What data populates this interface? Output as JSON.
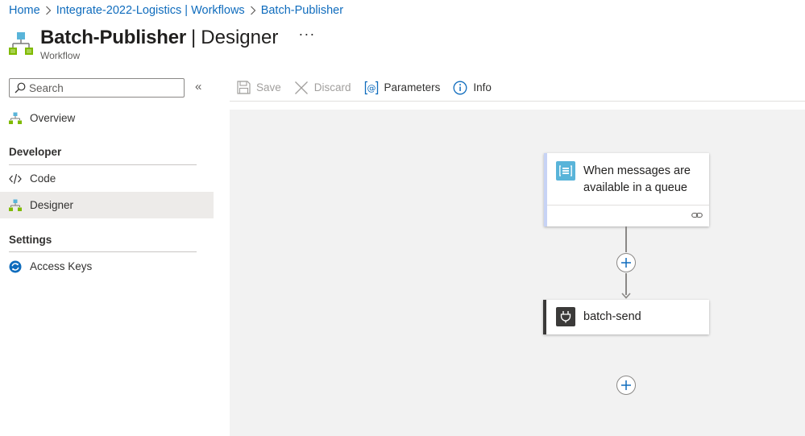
{
  "breadcrumb": {
    "items": [
      "Home",
      "Integrate-2022-Logistics | Workflows",
      "Batch-Publisher"
    ],
    "separator": ">"
  },
  "header": {
    "title": "Batch-Publisher",
    "pipe": "|",
    "page": "Designer",
    "more": "···",
    "subtitle": "Workflow"
  },
  "sidebar": {
    "search_placeholder": "Search",
    "collapse": "«",
    "overview": "Overview",
    "sections": [
      {
        "heading": "Developer",
        "items": [
          "Code",
          "Designer"
        ]
      },
      {
        "heading": "Settings",
        "items": [
          "Access Keys"
        ]
      }
    ],
    "active_item": "Designer"
  },
  "toolbar": {
    "save": "Save",
    "discard": "Discard",
    "parameters": "Parameters",
    "info": "Info"
  },
  "workflow": {
    "trigger": {
      "label": "When messages are available in a queue",
      "icon": "queue-icon",
      "accent": "#59b4d9"
    },
    "action": {
      "label": "batch-send",
      "icon": "plug-icon",
      "accent": "#3b3a39"
    },
    "add_step": "+"
  },
  "colors": {
    "link": "#0f6cbd",
    "canvas": "#f2f2f2",
    "active_nav": "#edebe9",
    "info_blue": "#0f6cbd"
  }
}
